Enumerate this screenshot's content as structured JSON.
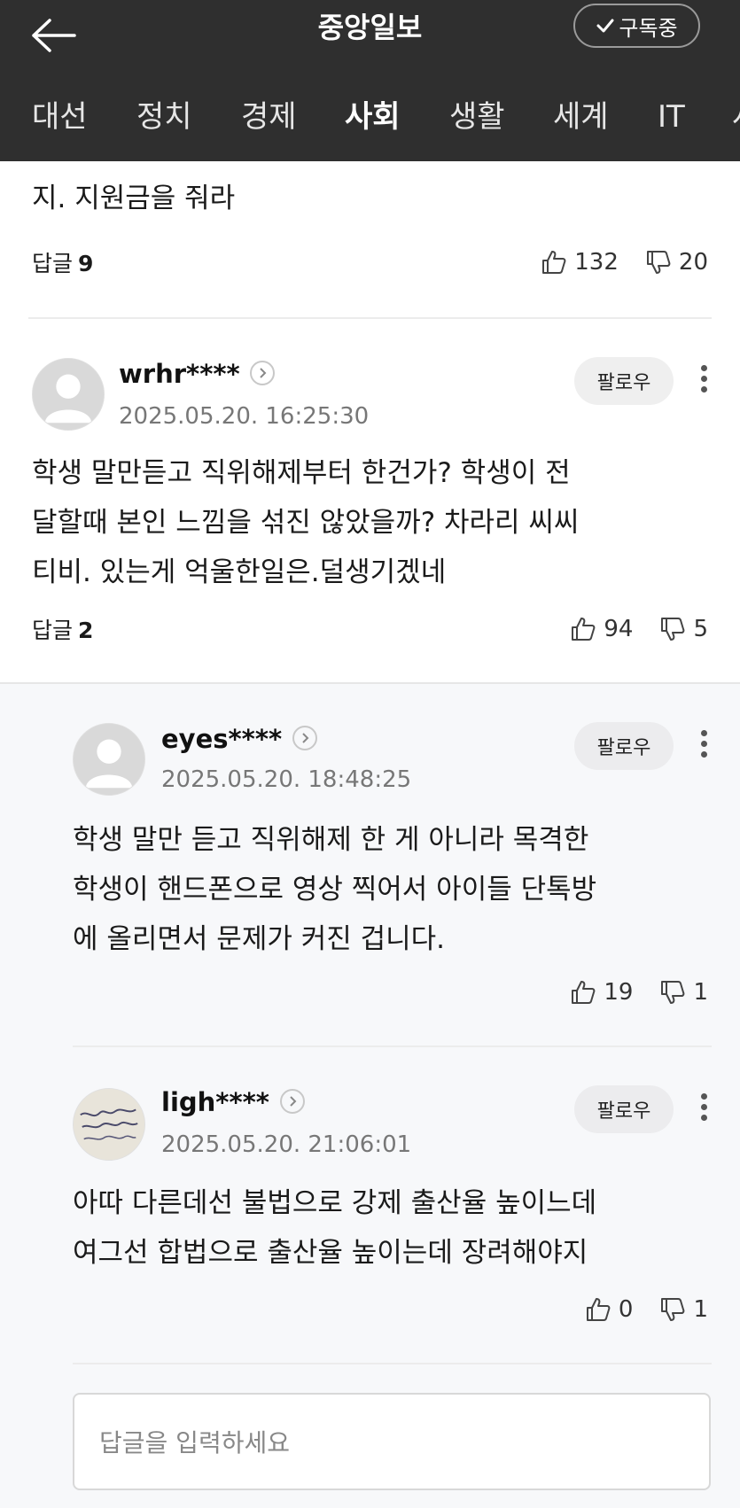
{
  "header": {
    "title": "중앙일보",
    "subscribe_label": "구독중"
  },
  "nav": {
    "tabs": [
      "대선",
      "정치",
      "경제",
      "사회",
      "생활",
      "세계",
      "IT",
      "사"
    ],
    "active_index": 3
  },
  "previous_comment": {
    "text_tail": "지. 지원금을 줘라",
    "reply_label": "답글",
    "reply_count": "9",
    "likes": "132",
    "dislikes": "20"
  },
  "comments": [
    {
      "username": "wrhr****",
      "timestamp": "2025.05.20. 16:25:30",
      "follow_label": "팔로우",
      "lines": [
        "학생 말만듣고 직위해제부터 한건가? 학생이 전",
        "달할때 본인 느낌을 섞진 않았을까? 차라리 씨씨",
        "티비. 있는게 억울한일은.덜생기겠네"
      ],
      "reply_label": "답글",
      "reply_count": "2",
      "likes": "94",
      "dislikes": "5"
    }
  ],
  "replies": [
    {
      "username": "eyes****",
      "timestamp": "2025.05.20. 18:48:25",
      "follow_label": "팔로우",
      "lines": [
        "학생 말만 듣고 직위해제 한 게 아니라 목격한",
        "학생이 핸드폰으로 영상 찍어서 아이들 단톡방",
        "에 올리면서 문제가 커진 겁니다."
      ],
      "likes": "19",
      "dislikes": "1"
    },
    {
      "username": "ligh****",
      "timestamp": "2025.05.20. 21:06:01",
      "follow_label": "팔로우",
      "lines": [
        "아따 다른데선 불법으로 강제 출산율 높이느데",
        "여그선 합법으로 출산율 높이는데 장려해야지"
      ],
      "likes": "0",
      "dislikes": "1"
    }
  ],
  "reply_input": {
    "placeholder": "답글을 입력하세요"
  },
  "colors": {
    "header_bg": "#2f2f2f",
    "reply_bg": "#f7f8fa",
    "follow_bg": "#efefef"
  }
}
